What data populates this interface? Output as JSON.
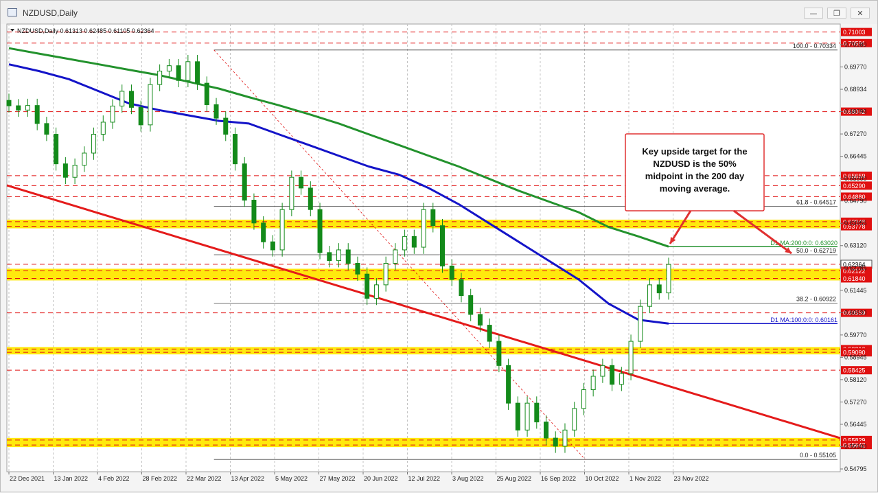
{
  "window": {
    "title": "NZDUSD,Daily",
    "minimize_glyph": "—",
    "restore_glyph": "❐",
    "close_glyph": "✕"
  },
  "chart_data": {
    "type": "candlestick",
    "symbol_header": "NZDUSD,Daily  0.61313  0.62485  0.61105  0.62364",
    "y_ticks": [
      "0.70080",
      "0.69770",
      "0.68934",
      "0.68098",
      "0.67270",
      "0.66445",
      "0.65600",
      "0.64790",
      "0.63955",
      "0.63120",
      "0.62285",
      "0.61445",
      "0.60630",
      "0.59770",
      "0.58945",
      "0.58120",
      "0.57270",
      "0.56445",
      "0.55600",
      "0.54795"
    ],
    "x_ticks": [
      "22 Dec 2021",
      "13 Jan 2022",
      "4 Feb 2022",
      "28 Feb 2022",
      "22 Mar 2022",
      "13 Apr 2022",
      "5 May 2022",
      "27 May 2022",
      "20 Jun 2022",
      "12 Jul 2022",
      "3 Aug 2022",
      "25 Aug 2022",
      "16 Sep 2022",
      "10 Oct 2022",
      "1 Nov 2022",
      "23 Nov 2022"
    ],
    "y_range": [
      0.5465,
      0.713
    ],
    "level_tags": [
      {
        "label": "0.71003",
        "value": 0.71003
      },
      {
        "label": "0.70591",
        "value": 0.70591
      },
      {
        "label": "0.68042",
        "value": 0.68042
      },
      {
        "label": "0.65659",
        "value": 0.65659
      },
      {
        "label": "0.65290",
        "value": 0.6529
      },
      {
        "label": "0.64880",
        "value": 0.6488
      },
      {
        "label": "0.63948",
        "value": 0.63948
      },
      {
        "label": "0.63778",
        "value": 0.63778
      },
      {
        "label": "0.62364",
        "value": 0.62364,
        "current": true
      },
      {
        "label": "0.62122",
        "value": 0.62122
      },
      {
        "label": "0.61840",
        "value": 0.6184
      },
      {
        "label": "0.60559",
        "value": 0.60559
      },
      {
        "label": "0.59210",
        "value": 0.5921
      },
      {
        "label": "0.59090",
        "value": 0.5909
      },
      {
        "label": "0.58425",
        "value": 0.58425
      },
      {
        "label": "0.55829",
        "value": 0.55829
      },
      {
        "label": "0.55642",
        "value": 0.55642
      }
    ],
    "yellow_zones": [
      [
        0.63778,
        0.63948
      ],
      [
        0.6184,
        0.62122
      ],
      [
        0.5909,
        0.5921
      ],
      [
        0.55642,
        0.55829
      ]
    ],
    "fib_levels": [
      {
        "label": "100.0 - 0.70334",
        "value": 0.70334
      },
      {
        "label": "61.8 - 0.64517",
        "value": 0.64517
      },
      {
        "label": "50.0 - 0.62719",
        "value": 0.62719
      },
      {
        "label": "38.2 - 0.60922",
        "value": 0.60922
      },
      {
        "label": "0.0 - 0.55105",
        "value": 0.55105
      }
    ],
    "ma_labels": {
      "ma200": "D1 MA:200:0:0: 0.63020",
      "ma100": "D1 MA:100:0:0: 0.60161"
    },
    "ma200_values": [
      0.704,
      0.702,
      0.7,
      0.698,
      0.696,
      0.694,
      0.6915,
      0.689,
      0.6858,
      0.6828,
      0.6795,
      0.676,
      0.672,
      0.668,
      0.664,
      0.66,
      0.6555,
      0.651,
      0.647,
      0.643,
      0.6375,
      0.634,
      0.6302
    ],
    "ma100_values": [
      0.698,
      0.6955,
      0.6925,
      0.688,
      0.6835,
      0.681,
      0.679,
      0.677,
      0.676,
      0.672,
      0.668,
      0.664,
      0.66,
      0.657,
      0.652,
      0.646,
      0.639,
      0.632,
      0.625,
      0.618,
      0.609,
      0.603,
      0.6016
    ],
    "close_prices": [
      0.6826,
      0.681,
      0.6827,
      0.676,
      0.672,
      0.661,
      0.656,
      0.6605,
      0.665,
      0.672,
      0.6765,
      0.6825,
      0.688,
      0.682,
      0.6755,
      0.6905,
      0.6955,
      0.6975,
      0.692,
      0.699,
      0.691,
      0.683,
      0.678,
      0.672,
      0.661,
      0.6475,
      0.639,
      0.632,
      0.629,
      0.644,
      0.656,
      0.652,
      0.644,
      0.628,
      0.625,
      0.629,
      0.624,
      0.62,
      0.611,
      0.616,
      0.624,
      0.629,
      0.634,
      0.63,
      0.644,
      0.638,
      0.623,
      0.618,
      0.612,
      0.605,
      0.601,
      0.595,
      0.586,
      0.572,
      0.562,
      0.572,
      0.565,
      0.559,
      0.556,
      0.562,
      0.57,
      0.577,
      0.582,
      0.586,
      0.579,
      0.583,
      0.595,
      0.608,
      0.616,
      0.613,
      0.6236
    ],
    "annotation_text": "Key upside target for the NZDUSD is the 50% midpoint in the 200 day moving average."
  },
  "colors": {
    "ma200": "#23922d",
    "ma100": "#1414c8",
    "trendline": "#e41b1b",
    "yellow_zone": "#ffe800",
    "level_tag": "#e01010",
    "candle": "#138a1a",
    "annotation_border": "#e03030"
  }
}
